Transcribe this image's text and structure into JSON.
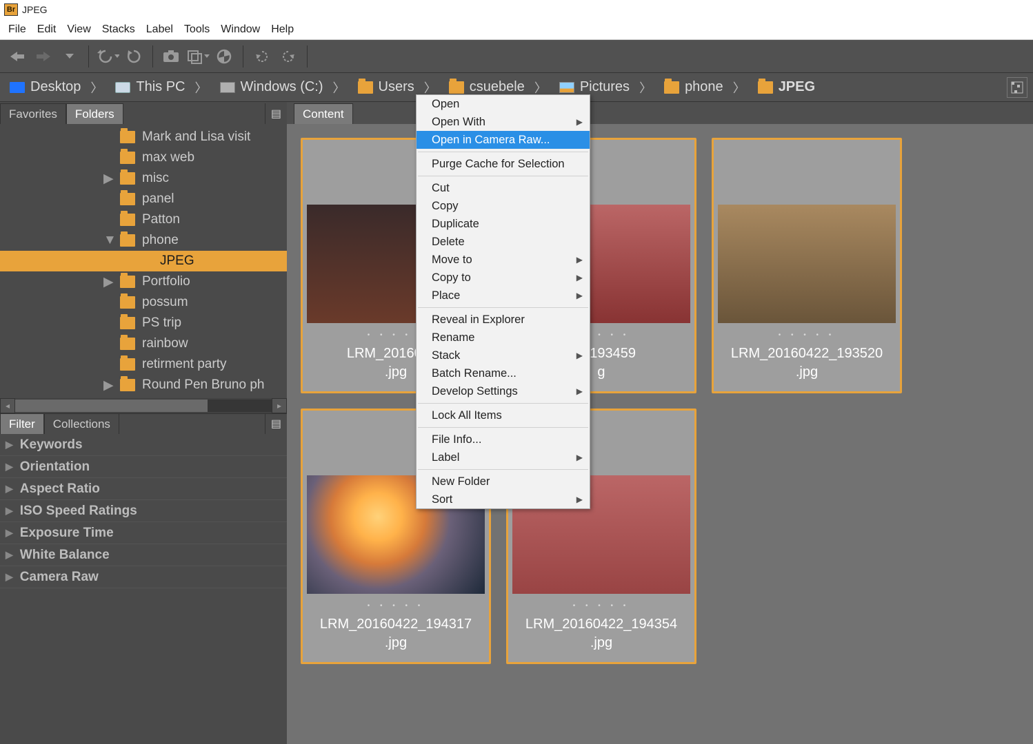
{
  "window": {
    "title": "JPEG",
    "app_badge": "Br"
  },
  "menus": [
    "File",
    "Edit",
    "View",
    "Stacks",
    "Label",
    "Tools",
    "Window",
    "Help"
  ],
  "path": [
    {
      "label": "Desktop",
      "icon": "desktop"
    },
    {
      "label": "This PC",
      "icon": "pc"
    },
    {
      "label": "Windows (C:)",
      "icon": "drive"
    },
    {
      "label": "Users",
      "icon": "folder"
    },
    {
      "label": "csuebele",
      "icon": "folder"
    },
    {
      "label": "Pictures",
      "icon": "piclib"
    },
    {
      "label": "phone",
      "icon": "folder"
    },
    {
      "label": "JPEG",
      "icon": "folder",
      "current": true
    }
  ],
  "left_tabs": {
    "items": [
      "Favorites",
      "Folders"
    ],
    "active": 1
  },
  "folders": [
    {
      "label": "Mark and Lisa visit",
      "depth": 0
    },
    {
      "label": "max web",
      "depth": 0
    },
    {
      "label": "misc",
      "depth": 0,
      "twist": "right"
    },
    {
      "label": "panel",
      "depth": 0
    },
    {
      "label": "Patton",
      "depth": 0
    },
    {
      "label": "phone",
      "depth": 0,
      "twist": "down"
    },
    {
      "label": "JPEG",
      "depth": 1,
      "selected": true
    },
    {
      "label": "Portfolio",
      "depth": 0,
      "twist": "right"
    },
    {
      "label": "possum",
      "depth": 0
    },
    {
      "label": "PS trip",
      "depth": 0
    },
    {
      "label": "rainbow",
      "depth": 0
    },
    {
      "label": "retirment party",
      "depth": 0
    },
    {
      "label": "Round Pen   Bruno ph",
      "depth": 0,
      "twist": "right"
    }
  ],
  "filter_tabs": {
    "items": [
      "Filter",
      "Collections"
    ],
    "active": 0
  },
  "filters": [
    "Keywords",
    "Orientation",
    "Aspect Ratio",
    "ISO Speed Ratings",
    "Exposure Time",
    "White Balance",
    "Camera Raw"
  ],
  "content_tab": "Content",
  "thumbs": [
    {
      "name": "LRM_20160422\n.jpg",
      "kind": "people1"
    },
    {
      "name": "22_193459\ng",
      "kind": "people2"
    },
    {
      "name": "LRM_20160422_193520\n.jpg",
      "kind": "people3"
    },
    {
      "name": "LRM_20160422_194317\n.jpg",
      "kind": "sunset"
    },
    {
      "name": "LRM_20160422_194354\n.jpg",
      "kind": "people5"
    }
  ],
  "context_menu": {
    "groups": [
      [
        "Open",
        {
          "label": "Open With",
          "sub": true
        },
        {
          "label": "Open in Camera Raw...",
          "hl": true
        }
      ],
      [
        "Purge Cache for Selection"
      ],
      [
        "Cut",
        "Copy",
        "Duplicate",
        "Delete",
        {
          "label": "Move to",
          "sub": true
        },
        {
          "label": "Copy to",
          "sub": true
        },
        {
          "label": "Place",
          "sub": true
        }
      ],
      [
        "Reveal in Explorer",
        "Rename",
        {
          "label": "Stack",
          "sub": true
        },
        "Batch Rename...",
        {
          "label": "Develop Settings",
          "sub": true
        }
      ],
      [
        "Lock All Items"
      ],
      [
        "File Info...",
        {
          "label": "Label",
          "sub": true
        }
      ],
      [
        "New Folder",
        {
          "label": "Sort",
          "sub": true
        }
      ]
    ]
  }
}
